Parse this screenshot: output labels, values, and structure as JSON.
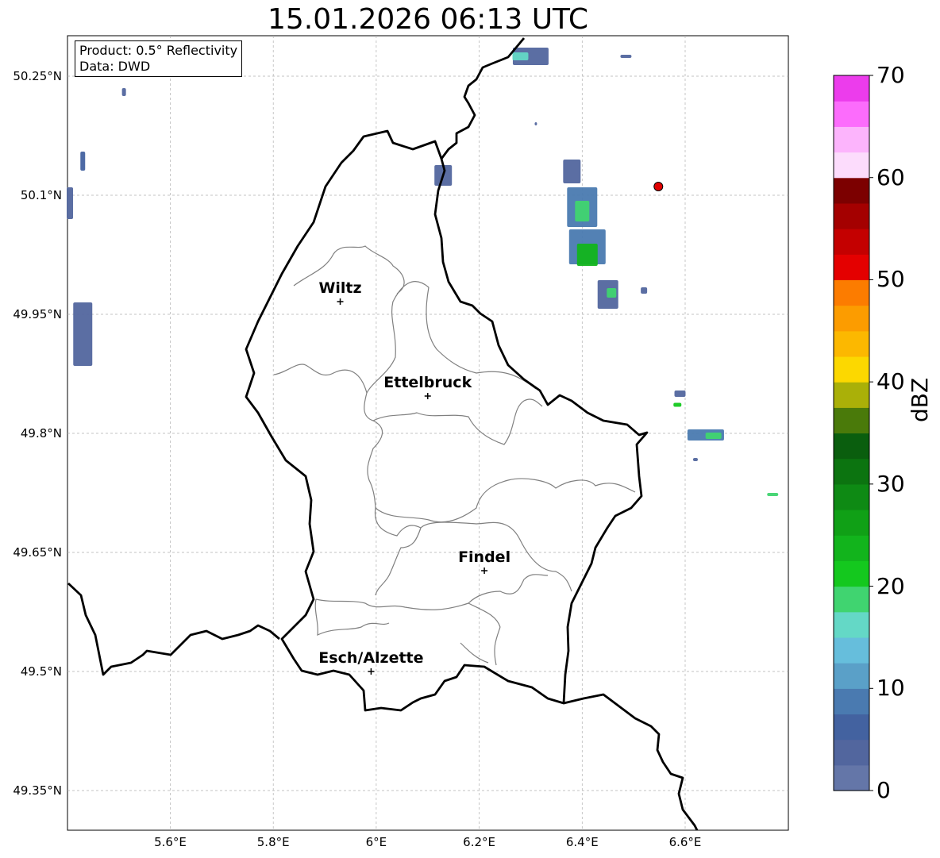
{
  "title": "15.01.2026 06:13 UTC",
  "info_box": {
    "product": "Product: 0.5° Reflectivity",
    "data": "Data: DWD"
  },
  "map": {
    "lat_ticks": [
      "50.25°N",
      "50.1°N",
      "49.95°N",
      "49.8°N",
      "49.65°N",
      "49.5°N",
      "49.35°N"
    ],
    "lon_ticks": [
      "5.6°E",
      "5.8°E",
      "6°E",
      "6.2°E",
      "6.4°E",
      "6.6°E"
    ],
    "cities": [
      {
        "name": "Wiltz",
        "lon": 5.93,
        "lat": 49.966
      },
      {
        "name": "Ettelbruck",
        "lon": 6.1,
        "lat": 49.847
      },
      {
        "name": "Findel",
        "lon": 6.21,
        "lat": 49.627
      },
      {
        "name": "Esch/Alzette",
        "lon": 5.99,
        "lat": 49.5
      }
    ],
    "radar_site": {
      "lon": 6.548,
      "lat": 50.111,
      "color": "#e00000"
    }
  },
  "colorbar": {
    "label": "dBZ",
    "ticks": [
      "0",
      "10",
      "20",
      "30",
      "40",
      "50",
      "60",
      "70"
    ],
    "colors": [
      "#6476a8",
      "#52669e",
      "#4362a0",
      "#4a7ab0",
      "#5aa0c8",
      "#66bedc",
      "#64d8c6",
      "#40d470",
      "#14c81e",
      "#12b41c",
      "#10a016",
      "#0e8a14",
      "#0c7410",
      "#0a5e0e",
      "#4a7a0a",
      "#aab008",
      "#fcd800",
      "#fcb800",
      "#fc9c00",
      "#fc7c00",
      "#e40000",
      "#c40000",
      "#a40000",
      "#7c0000",
      "#fcdcfc",
      "#fcb4fc",
      "#fc6cfc",
      "#ec3cec"
    ]
  },
  "echoes": [
    {
      "lon": 6.3,
      "lat": 50.275,
      "w": 45,
      "h": 22,
      "color": "#52669e"
    },
    {
      "lon": 6.28,
      "lat": 50.275,
      "w": 20,
      "h": 10,
      "color": "#64d8c6"
    },
    {
      "lon": 6.13,
      "lat": 50.125,
      "w": 22,
      "h": 26,
      "color": "#52669e"
    },
    {
      "lon": 6.38,
      "lat": 50.13,
      "w": 22,
      "h": 30,
      "color": "#52669e"
    },
    {
      "lon": 6.4,
      "lat": 50.085,
      "w": 38,
      "h": 50,
      "color": "#4a7ab0"
    },
    {
      "lon": 6.4,
      "lat": 50.08,
      "w": 18,
      "h": 26,
      "color": "#40d470"
    },
    {
      "lon": 6.41,
      "lat": 50.035,
      "w": 46,
      "h": 44,
      "color": "#4a7ab0"
    },
    {
      "lon": 6.41,
      "lat": 50.025,
      "w": 26,
      "h": 28,
      "color": "#12b41c"
    },
    {
      "lon": 6.45,
      "lat": 49.975,
      "w": 26,
      "h": 36,
      "color": "#52669e"
    },
    {
      "lon": 6.457,
      "lat": 49.977,
      "w": 12,
      "h": 12,
      "color": "#40d470"
    },
    {
      "lon": 6.52,
      "lat": 49.98,
      "w": 8,
      "h": 8,
      "color": "#52669e"
    },
    {
      "lon": 6.59,
      "lat": 49.85,
      "w": 14,
      "h": 8,
      "color": "#52669e"
    },
    {
      "lon": 6.585,
      "lat": 49.836,
      "w": 10,
      "h": 5,
      "color": "#14c81e"
    },
    {
      "lon": 6.64,
      "lat": 49.798,
      "w": 46,
      "h": 14,
      "color": "#4a7ab0"
    },
    {
      "lon": 6.655,
      "lat": 49.797,
      "w": 20,
      "h": 8,
      "color": "#40d470"
    },
    {
      "lon": 6.62,
      "lat": 49.767,
      "w": 6,
      "h": 4,
      "color": "#52669e"
    },
    {
      "lon": 6.77,
      "lat": 49.723,
      "w": 14,
      "h": 4,
      "color": "#40d470"
    },
    {
      "lon": 5.43,
      "lat": 49.925,
      "w": 24,
      "h": 80,
      "color": "#52669e"
    },
    {
      "lon": 5.405,
      "lat": 50.09,
      "w": 8,
      "h": 40,
      "color": "#52669e"
    },
    {
      "lon": 5.43,
      "lat": 50.143,
      "w": 6,
      "h": 24,
      "color": "#4362a0"
    },
    {
      "lon": 5.51,
      "lat": 50.23,
      "w": 5,
      "h": 10,
      "color": "#52669e"
    },
    {
      "lon": 6.485,
      "lat": 50.275,
      "w": 14,
      "h": 4,
      "color": "#52669e"
    },
    {
      "lon": 6.31,
      "lat": 50.19,
      "w": 3,
      "h": 4,
      "color": "#52669e"
    }
  ]
}
